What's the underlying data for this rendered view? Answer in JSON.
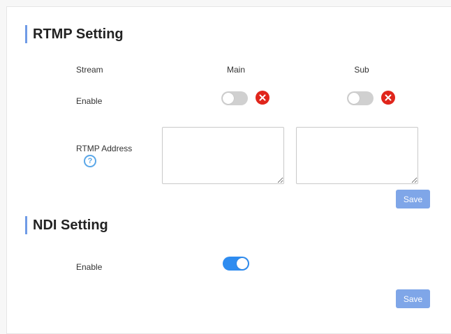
{
  "rtmp": {
    "title": "RTMP Setting",
    "stream_label": "Stream",
    "main_label": "Main",
    "sub_label": "Sub",
    "enable_label": "Enable",
    "main_enabled": false,
    "sub_enabled": false,
    "address_label": "RTMP Address",
    "main_address": "",
    "sub_address": "",
    "save_label": "Save"
  },
  "ndi": {
    "title": "NDI Setting",
    "enable_label": "Enable",
    "enabled": true,
    "save_label": "Save"
  },
  "icons": {
    "status_error": "close-circle-icon",
    "help": "question-circle-icon"
  },
  "colors": {
    "accent": "#2e8cf0",
    "section_bar": "#6f9be6",
    "save_button": "#7fa6e8",
    "error": "#e0251b",
    "switch_off": "#d0d0d0"
  }
}
